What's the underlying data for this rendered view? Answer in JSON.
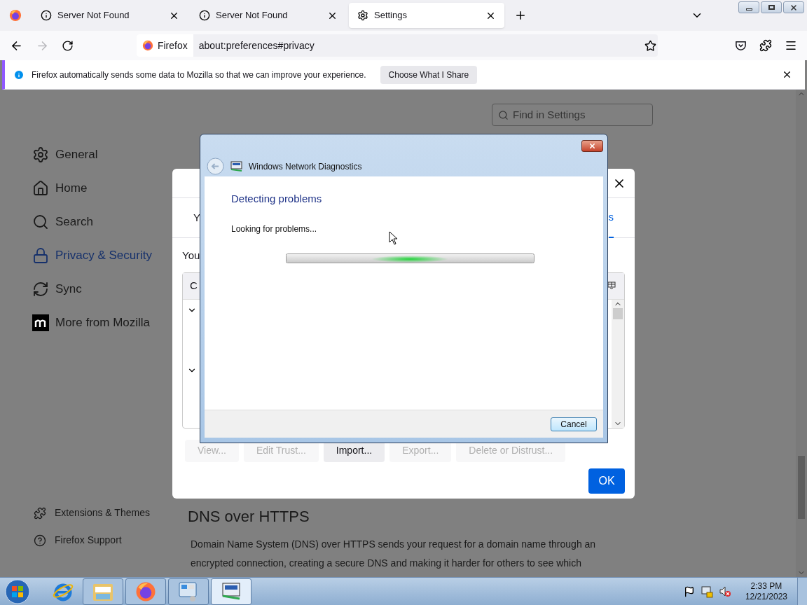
{
  "browser": {
    "tabs": [
      {
        "title": "Server Not Found",
        "kind": "info",
        "selected": false
      },
      {
        "title": "Server Not Found",
        "kind": "info",
        "selected": false
      },
      {
        "title": "Settings",
        "kind": "settings",
        "selected": true
      }
    ],
    "address_bar": {
      "identity": "Firefox",
      "url": "about:preferences#privacy"
    }
  },
  "notification": {
    "message": "Firefox automatically sends some data to Mozilla so that we can improve your experience.",
    "button": "Choose What I Share"
  },
  "settings": {
    "search": {
      "placeholder": "Find in Settings"
    },
    "nav": [
      {
        "label": "General",
        "kind": "general",
        "selected": false
      },
      {
        "label": "Home",
        "kind": "home",
        "selected": false
      },
      {
        "label": "Search",
        "kind": "search",
        "selected": false
      },
      {
        "label": "Privacy & Security",
        "kind": "privacy",
        "selected": true
      },
      {
        "label": "Sync",
        "kind": "sync",
        "selected": false
      },
      {
        "label": "More from Mozilla",
        "kind": "mozilla",
        "selected": false
      }
    ],
    "footer_links": [
      {
        "label": "Extensions & Themes",
        "kind": "extensions"
      },
      {
        "label": "Firefox Support",
        "kind": "help"
      }
    ],
    "section": {
      "heading": "DNS over HTTPS",
      "text": "Domain Name System (DNS) over HTTPS sends your request for a domain name through an encrypted connection, creating a secure DNS and making it harder for others to see which"
    }
  },
  "certificate_dialog": {
    "tab_fragments": [
      {
        "text": "Y",
        "selected": false
      },
      {
        "text": "s",
        "selected": true
      }
    ],
    "intro_fragment": "You",
    "column_fragment": "C",
    "buttons": [
      {
        "label": "View...",
        "disabled": true
      },
      {
        "label": "Edit Trust...",
        "disabled": true
      },
      {
        "label": "Import...",
        "disabled": false
      },
      {
        "label": "Export...",
        "disabled": true
      },
      {
        "label": "Delete or Distrust...",
        "disabled": true
      }
    ],
    "ok": "OK"
  },
  "diagnostics": {
    "title": "Windows Network Diagnostics",
    "heading": "Detecting problems",
    "status": "Looking for problems...",
    "cancel": "Cancel"
  },
  "taskbar": {
    "apps": [
      {
        "kind": "ie",
        "running": false,
        "selected": false
      },
      {
        "kind": "explorer",
        "running": true,
        "selected": false
      },
      {
        "kind": "firefox",
        "running": true,
        "selected": false
      },
      {
        "kind": "control-panel",
        "running": true,
        "selected": false
      },
      {
        "kind": "network",
        "running": true,
        "selected": true
      }
    ],
    "clock": {
      "time": "2:33 PM",
      "date": "12/21/2023"
    }
  }
}
